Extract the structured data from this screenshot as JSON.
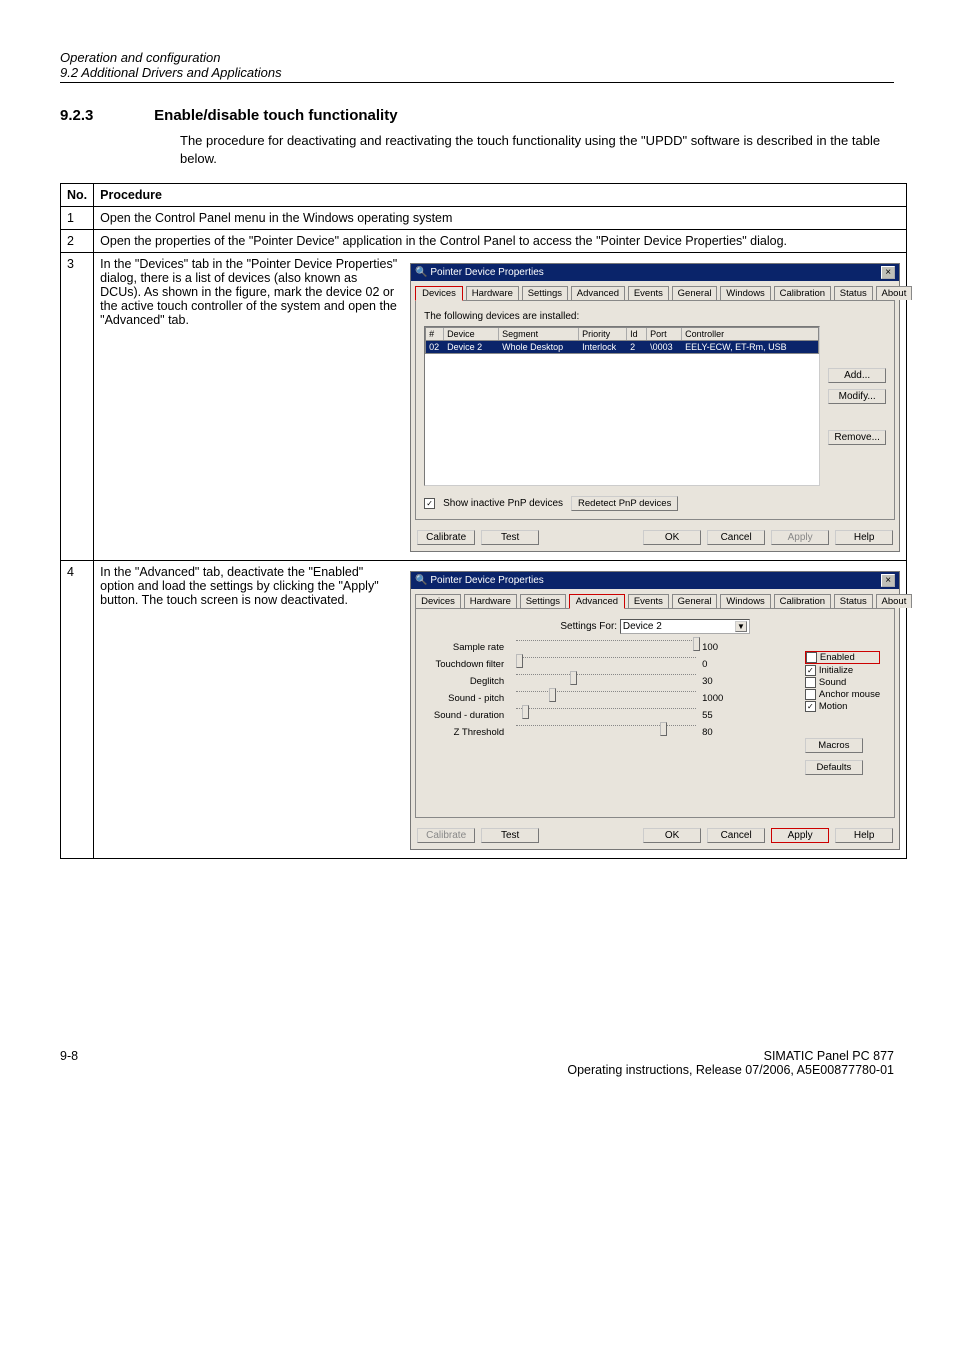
{
  "header": {
    "doc_title": "Operation and configuration",
    "section_line": "9.2 Additional Drivers and Applications"
  },
  "section": {
    "number": "9.2.3",
    "title": "Enable/disable touch functionality",
    "intro": "The procedure for deactivating and reactivating the touch functionality using the \"UPDD\" software is described in the table below."
  },
  "table": {
    "h_no": "No.",
    "h_proc": "Procedure",
    "rows": [
      {
        "no": "1",
        "desc": "Open the Control Panel menu in the Windows operating system"
      },
      {
        "no": "2",
        "desc": "Open the properties of the \"Pointer Device\" application in the Control Panel to access the \"Pointer Device Properties\" dialog."
      },
      {
        "no": "3",
        "desc": "In the \"Devices\" tab in the \"Pointer Device Properties\" dialog, there is a list of devices (also known as DCUs). As shown in the figure, mark the device 02 or the active touch controller of the system and open the \"Advanced\" tab."
      },
      {
        "no": "4",
        "desc": "In the \"Advanced\" tab, deactivate the \"Enabled\" option and load the settings by clicking the \"Apply\" button. The touch screen is now deactivated."
      }
    ]
  },
  "dlg1": {
    "title": "Pointer Device Properties",
    "tabs": [
      "Devices",
      "Hardware",
      "Settings",
      "Advanced",
      "Events",
      "General",
      "Windows",
      "Calibration",
      "Status",
      "About"
    ],
    "body_label": "The following devices are installed:",
    "cols": {
      "num": "#",
      "device": "Device",
      "segment": "Segment",
      "priority": "Priority",
      "id": "Id",
      "port": "Port",
      "controller": "Controller"
    },
    "row": {
      "num": "02",
      "device": "Device 2",
      "segment": "Whole Desktop",
      "priority": "Interlock",
      "id": "2",
      "port": "\\0003",
      "controller": "EELY-ECW, ET-Rm, USB"
    },
    "buttons": {
      "add": "Add...",
      "modify": "Modify...",
      "remove": "Remove..."
    },
    "show_inactive": "Show inactive PnP devices",
    "redetect": "Redetect PnP devices",
    "footer": {
      "calibrate": "Calibrate",
      "test": "Test",
      "ok": "OK",
      "cancel": "Cancel",
      "apply": "Apply",
      "help": "Help"
    }
  },
  "dlg2": {
    "title": "Pointer Device Properties",
    "tabs": [
      "Devices",
      "Hardware",
      "Settings",
      "Advanced",
      "Events",
      "General",
      "Windows",
      "Calibration",
      "Status",
      "About"
    ],
    "settings_for_label": "Settings For:",
    "settings_for_value": "Device 2",
    "sliders": [
      {
        "label": "Sample rate",
        "value": "100",
        "pos": 100
      },
      {
        "label": "Touchdown filter",
        "value": "0",
        "pos": 0
      },
      {
        "label": "Deglitch",
        "value": "30",
        "pos": 30
      },
      {
        "label": "Sound - pitch",
        "value": "1000",
        "pos": 18
      },
      {
        "label": "Sound - duration",
        "value": "55",
        "pos": 3
      },
      {
        "label": "Z Threshold",
        "value": "80",
        "pos": 80
      }
    ],
    "opts": {
      "enabled": "Enabled",
      "initialize": "Initialize",
      "sound": "Sound",
      "anchor": "Anchor mouse",
      "motion": "Motion"
    },
    "macros": "Macros",
    "defaults": "Defaults",
    "footer": {
      "calibrate": "Calibrate",
      "test": "Test",
      "ok": "OK",
      "cancel": "Cancel",
      "apply": "Apply",
      "help": "Help"
    }
  },
  "footer": {
    "left": "9-8",
    "right1": "SIMATIC Panel PC 877",
    "right2": "Operating instructions, Release 07/2006, A5E00877780-01"
  }
}
